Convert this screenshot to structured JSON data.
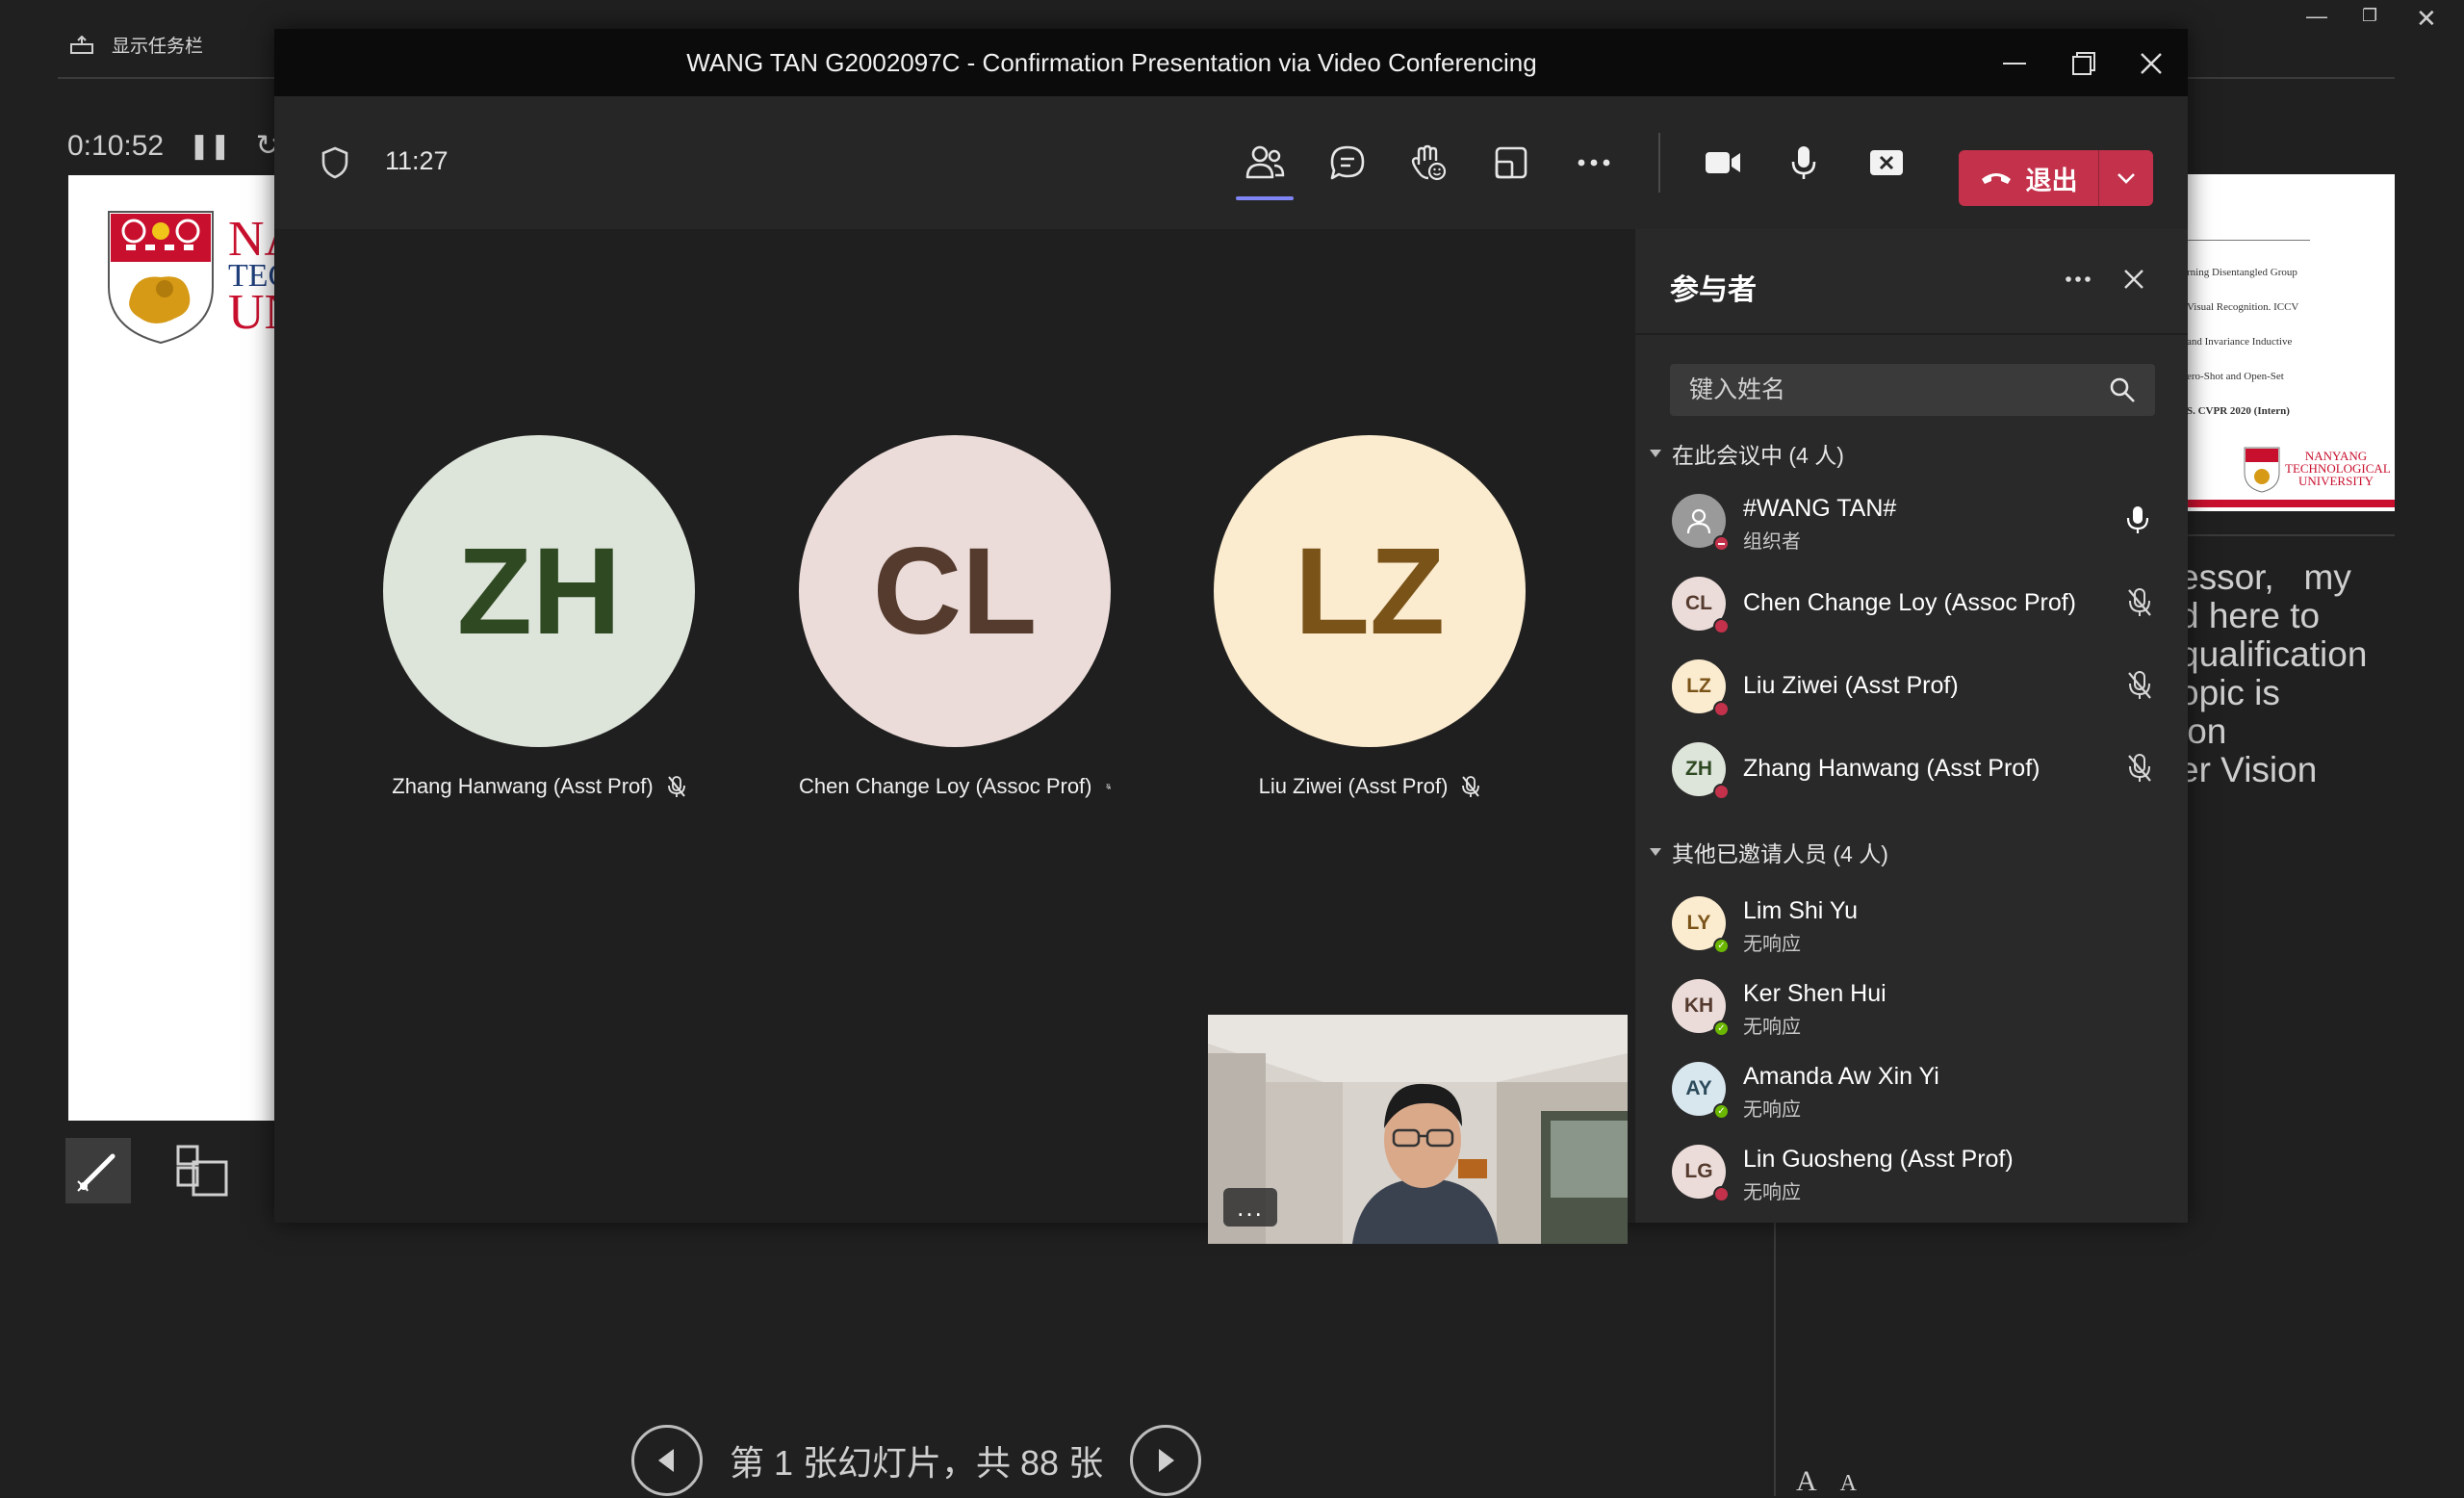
{
  "ppt": {
    "taskbar_label": "显示任务栏",
    "timer": "0:10:52",
    "slide_counter": "第 1 张幻灯片，共 88 张",
    "next_slide_lines": [
      "rning Disentangled Group",
      "Visual Recognition. ICCV",
      "and Invariance Inductive",
      "ero-Shot and Open-Set",
      "S. CVPR 2020 (Intern)"
    ],
    "next_slide_logo": "NANYANG TECHNOLOGICAL UNIVERSITY",
    "current_slide_logo_fragment": [
      "NA",
      "TEC",
      "UN"
    ],
    "notes": "essor,   my\nd here to\nqualification\nopic is\nion\ner Vision",
    "font_buttons": [
      "A",
      "A"
    ]
  },
  "window": {
    "title": "WANG TAN G2002097C - Confirmation Presentation via Video Conferencing"
  },
  "toolbar": {
    "elapsed": "11:27",
    "leave_label": "退出"
  },
  "stage": {
    "tiles": [
      {
        "initials": "ZH",
        "name": "Zhang Hanwang (Asst Prof)",
        "bg": "#dde4da",
        "fg": "#2f4a22"
      },
      {
        "initials": "CL",
        "name": "Chen Change Loy (Assoc Prof)",
        "bg": "#ebdcd9",
        "fg": "#553a2e"
      },
      {
        "initials": "LZ",
        "name": "Liu Ziwei (Asst Prof)",
        "bg": "#fbebcf",
        "fg": "#7a5318"
      }
    ],
    "self_more": "..."
  },
  "panel": {
    "title": "参与者",
    "search_placeholder": "键入姓名",
    "in_meeting_header": "在此会议中 (4 人)",
    "invited_header": "其他已邀请人员 (4 人)",
    "in_meeting": [
      {
        "initials": "",
        "name": "#WANG TAN#",
        "sub": "组织者",
        "mic": "on",
        "status": "busy",
        "bg": "#9a9a9a"
      },
      {
        "initials": "CL",
        "name": "Chen Change Loy (Assoc Prof)",
        "sub": "",
        "mic": "muted",
        "status": "busy",
        "bg": "#ebdcd9"
      },
      {
        "initials": "LZ",
        "name": "Liu Ziwei (Asst Prof)",
        "sub": "",
        "mic": "muted",
        "status": "busy",
        "bg": "#fbebcf"
      },
      {
        "initials": "ZH",
        "name": "Zhang Hanwang (Asst Prof)",
        "sub": "",
        "mic": "muted",
        "status": "busy",
        "bg": "#dde4da"
      }
    ],
    "invited": [
      {
        "initials": "LY",
        "name": "Lim Shi Yu",
        "sub": "无响应",
        "status": "available",
        "bg": "#fbebcf"
      },
      {
        "initials": "KH",
        "name": "Ker Shen Hui",
        "sub": "无响应",
        "status": "available",
        "bg": "#ebdcd9"
      },
      {
        "initials": "AY",
        "name": "Amanda Aw Xin Yi",
        "sub": "无响应",
        "status": "available",
        "bg": "#d8e6ee"
      },
      {
        "initials": "LG",
        "name": "Lin Guosheng (Asst Prof)",
        "sub": "无响应",
        "status": "busy",
        "bg": "#ebdcd9"
      }
    ],
    "colors": {
      "busy": "#c4314b",
      "available": "#6bb700",
      "accent": "#7f85f5"
    }
  }
}
